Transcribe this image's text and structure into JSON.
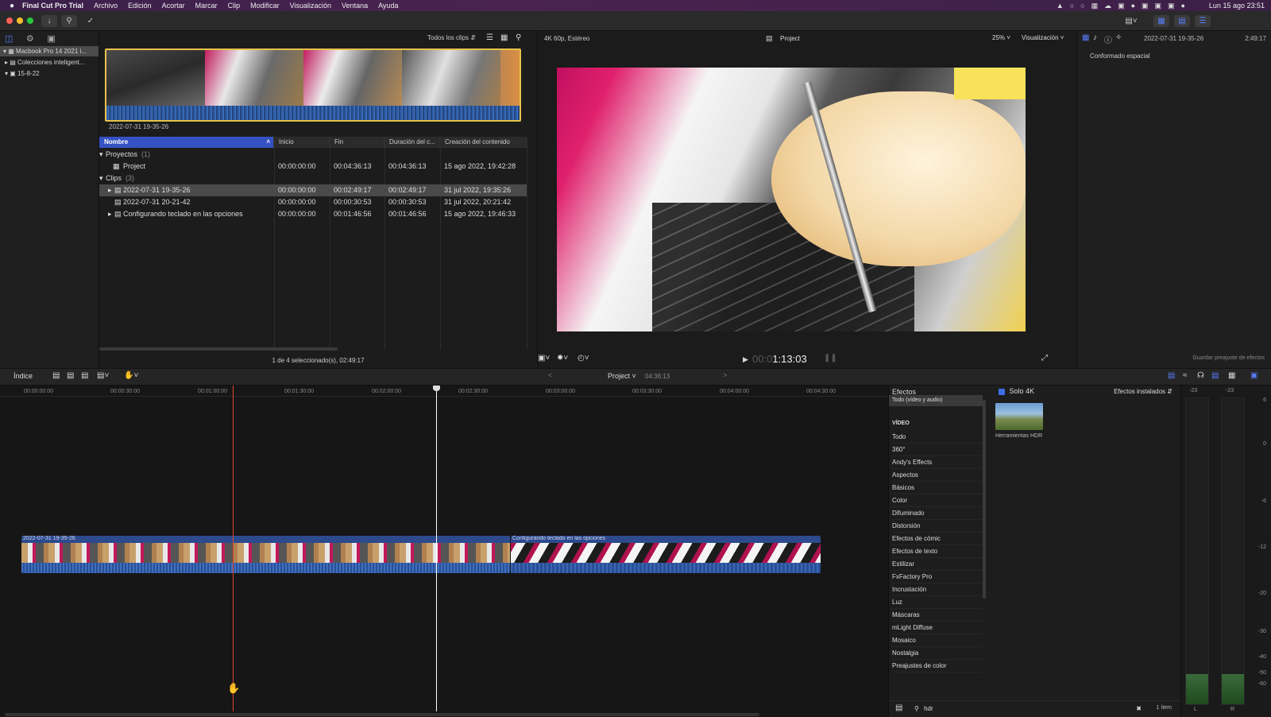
{
  "menubar": {
    "apple_icon": "apple-icon",
    "app_name": "Final Cut Pro Trial",
    "items": [
      "Archivo",
      "Edición",
      "Acortar",
      "Marcar",
      "Clip",
      "Modificar",
      "Visualización",
      "Ventana",
      "Ayuda"
    ],
    "datetime": "Lun 15 ago  23:51"
  },
  "libraries": {
    "items": [
      {
        "label": "Macbook Pro 14 2021 i..."
      },
      {
        "label": "Colecciones inteligent..."
      },
      {
        "label": "15-8-22"
      }
    ]
  },
  "browser": {
    "filter_label": "Todos los clips",
    "filmstrip_caption": "2022-07-31 19-35-26",
    "columns": [
      "Nombre",
      "Inicio",
      "Fin",
      "Duración del c...",
      "Creación del contenido"
    ],
    "groups": [
      {
        "label": "Proyectos",
        "count": "(1)"
      },
      {
        "label": "Clips",
        "count": "(3)"
      }
    ],
    "rows": [
      {
        "name": "Project",
        "start": "00:00:00:00",
        "end": "00:04:36:13",
        "dur": "00:04:36:13",
        "created": "15 ago 2022, 19:42:28"
      },
      {
        "name": "2022-07-31 19-35-26",
        "start": "00:00:00:00",
        "end": "00:02:49:17",
        "dur": "00:02:49:17",
        "created": "31 jul 2022, 19:35:26"
      },
      {
        "name": "2022-07-31 20-21-42",
        "start": "00:00:00:00",
        "end": "00:00:30:53",
        "dur": "00:00:30:53",
        "created": "31 jul 2022, 20:21:42"
      },
      {
        "name": "Configurando teclado en las opciones",
        "start": "00:00:00:00",
        "end": "00:01:46:56",
        "dur": "00:01:46:56",
        "created": "15 ago 2022, 19:46:33"
      }
    ],
    "status": "1 de 4 seleccionado(s), 02:49:17"
  },
  "viewer": {
    "format": "4K 60p, Estéreo",
    "project": "Project",
    "zoom": "25%",
    "view_label": "Visualización",
    "timecode_dim": "00:0",
    "timecode": "1:13:03"
  },
  "inspector": {
    "clip_name": "2022-07-31 19-35-26",
    "duration": "2:49:17",
    "section": "Conformado espacial",
    "save_preset": "Guardar preajuste de efectos"
  },
  "timeline_bar": {
    "index_label": "Índice",
    "project": "Project",
    "duration": "04:36:13"
  },
  "timeline": {
    "ruler": [
      "00:00:00:00",
      "00:00:30:00",
      "00:01:00:00",
      "00:01:30:00",
      "00:02:00:00",
      "00:02:30:00",
      "00:03:00:00",
      "00:03:30:00",
      "00:04:00:00",
      "00:04:30:00"
    ],
    "clip1_label": "2022-07-31 19-35-26",
    "clip2_label": "Configurando teclado en las opciones"
  },
  "effects": {
    "title": "Efectos",
    "solo4k": "Solo 4K",
    "installed": "Efectos instalados",
    "all_label": "Todo (vídeo y audio)",
    "video_header": "VÍDEO",
    "categories": [
      "Todo",
      "360°",
      "Andy's Effects",
      "Aspectos",
      "Básicos",
      "Color",
      "Difuminado",
      "Distorsión",
      "Efectos de cómic",
      "Efectos de texto",
      "Estilizar",
      "FxFactory Pro",
      "Incrustación",
      "Luz",
      "Máscaras",
      "mLight Diffuse",
      "Mosaico",
      "Nostalgia",
      "Preajustes de color"
    ],
    "result_label": "Herramientas HDR",
    "search_value": "hdr",
    "count": "1 ítem"
  },
  "meters": {
    "scale": [
      "6",
      "0",
      "-6",
      "-12",
      "-20",
      "-30",
      "-40",
      "-50",
      "-60"
    ],
    "top_labels": [
      "-23",
      "-23"
    ],
    "channels": [
      "L",
      "R"
    ]
  },
  "colors": {
    "selection": "#3552c4",
    "playhead": "#ffffff",
    "skimmer": "#e0452a",
    "clip_blue": "#2c4a8c"
  }
}
